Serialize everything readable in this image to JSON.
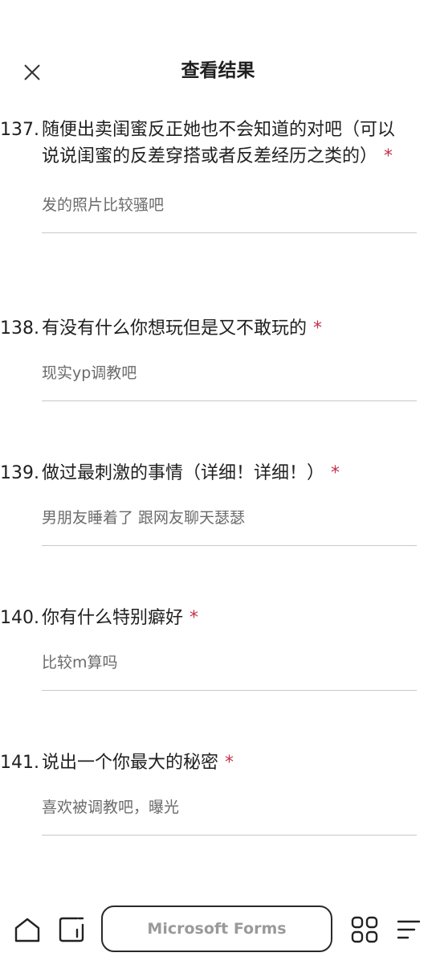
{
  "header": {
    "title": "查看结果",
    "close_icon": "close-icon"
  },
  "questions": [
    {
      "number": "137.",
      "title": "随便出卖闺蜜反正她也不会知道的对吧（可以说说闺蜜的反差穿搭或者反差经历之类的）",
      "required_mark": "*",
      "answer": "发的照片比较骚吧"
    },
    {
      "number": "138.",
      "title": "有没有什么你想玩但是又不敢玩的",
      "required_mark": "*",
      "answer": "现实yp调教吧"
    },
    {
      "number": "139.",
      "title": "做过最刺激的事情（详细！详细！）",
      "required_mark": "*",
      "answer": "男朋友睡着了 跟网友聊天瑟瑟"
    },
    {
      "number": "140.",
      "title": "你有什么特别癖好",
      "required_mark": "*",
      "answer": "比较m算吗"
    },
    {
      "number": "141.",
      "title": "说出一个你最大的秘密",
      "required_mark": "*",
      "answer": "喜欢被调教吧，曝光"
    }
  ],
  "bottom_bar": {
    "url_label": "Microsoft Forms",
    "icons": [
      "home-icon",
      "tabs-icon",
      "grid-apps-icon",
      "menu-icon"
    ]
  },
  "colors": {
    "required": "#c4314b",
    "answer_text": "#6b6b6b",
    "divider": "#c8c8c8"
  }
}
